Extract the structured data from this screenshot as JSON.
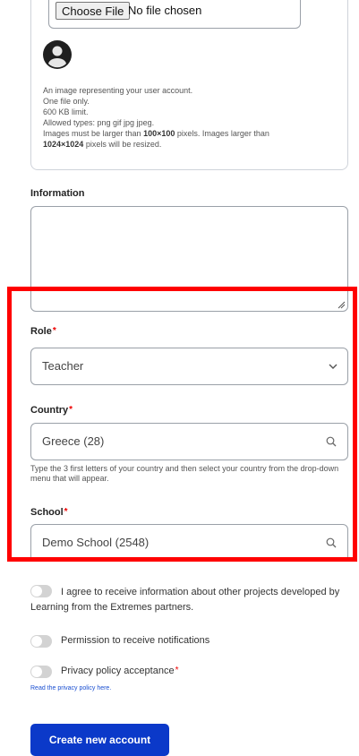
{
  "upload": {
    "button_label": "Choose File",
    "status_text": "No file chosen",
    "help_line1": "An image representing your user account.",
    "help_line2": "One file only.",
    "help_line3": "600 KB limit.",
    "help_line4": "Allowed types: png gif jpg jpeg.",
    "help_line5a": "Images must be larger than ",
    "help_min": "100×100",
    "help_line5b": " pixels. Images larger than",
    "help_max": "1024×1024",
    "help_line6b": " pixels will be resized."
  },
  "information": {
    "label": "Information",
    "value": ""
  },
  "role": {
    "label": "Role",
    "required": "*",
    "value": "Teacher"
  },
  "country": {
    "label": "Country",
    "required": "*",
    "value": "Greece (28)",
    "help": "Type the 3 first letters of your country and then select your country from the drop-down menu that will appear."
  },
  "school": {
    "label": "School",
    "required": "*",
    "value": "Demo School (2548)"
  },
  "toggles": {
    "projects": "I agree to receive information about other projects developed by Learning from the Extremes partners.",
    "notifications": "Permission to receive notifications",
    "privacy": "Privacy policy acceptance",
    "privacy_required": "*",
    "privacy_link": "Read the privacy policy here."
  },
  "submit": {
    "label": "Create new account"
  },
  "colors": {
    "primary": "#0b39c9",
    "highlight": "#ff0000",
    "required": "#e00000"
  },
  "icons": {
    "avatar": "user-avatar-icon",
    "chevron": "chevron-down-icon",
    "search": "search-icon"
  }
}
